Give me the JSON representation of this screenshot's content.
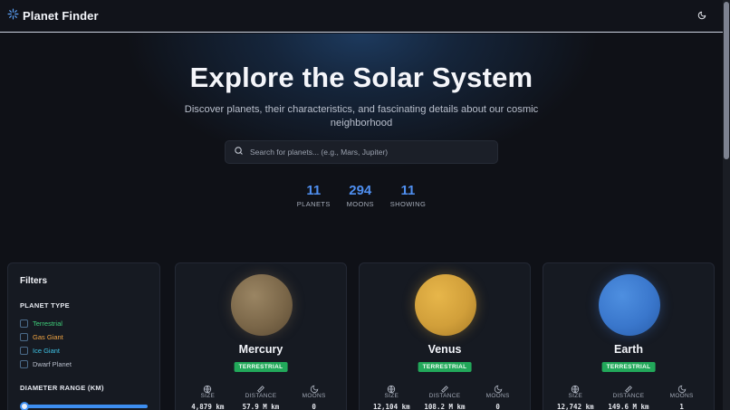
{
  "header": {
    "title": "Planet Finder",
    "logo_icon": "sparkle-icon",
    "theme_icon": "moon-icon"
  },
  "hero": {
    "title": "Explore the Solar System",
    "subtitle": "Discover planets, their characteristics, and fascinating details about our cosmic neighborhood"
  },
  "search": {
    "placeholder": "Search for planets... (e.g., Mars, Jupiter)",
    "value": ""
  },
  "stats": [
    {
      "value": "11",
      "label": "PLANETS"
    },
    {
      "value": "294",
      "label": "MOONS"
    },
    {
      "value": "11",
      "label": "SHOWING"
    }
  ],
  "filters": {
    "title": "Filters",
    "planet_type_label": "PLANET TYPE",
    "types": [
      {
        "label": "Terrestrial",
        "color": "#3fcf7a"
      },
      {
        "label": "Gas Giant",
        "color": "#f0a443"
      },
      {
        "label": "Ice Giant",
        "color": "#3fc3e6"
      },
      {
        "label": "Dwarf Planet",
        "color": "#b9bfcc"
      }
    ],
    "diameter_label": "DIAMETER RANGE (KM)"
  },
  "metric_labels": {
    "size": "SIZE",
    "distance": "DISTANCE",
    "moons": "MOONS"
  },
  "planets": [
    {
      "name": "Mercury",
      "type": "TERRESTRIAL",
      "size": "4,879 km",
      "distance": "57.9 M km",
      "moons": "0"
    },
    {
      "name": "Venus",
      "type": "TERRESTRIAL",
      "size": "12,104 km",
      "distance": "108.2 M km",
      "moons": "0"
    },
    {
      "name": "Earth",
      "type": "TERRESTRIAL",
      "size": "12,742 km",
      "distance": "149.6 M km",
      "moons": "1"
    }
  ],
  "colors": {
    "accent": "#4f8ff0",
    "badge": "#22a85a"
  }
}
